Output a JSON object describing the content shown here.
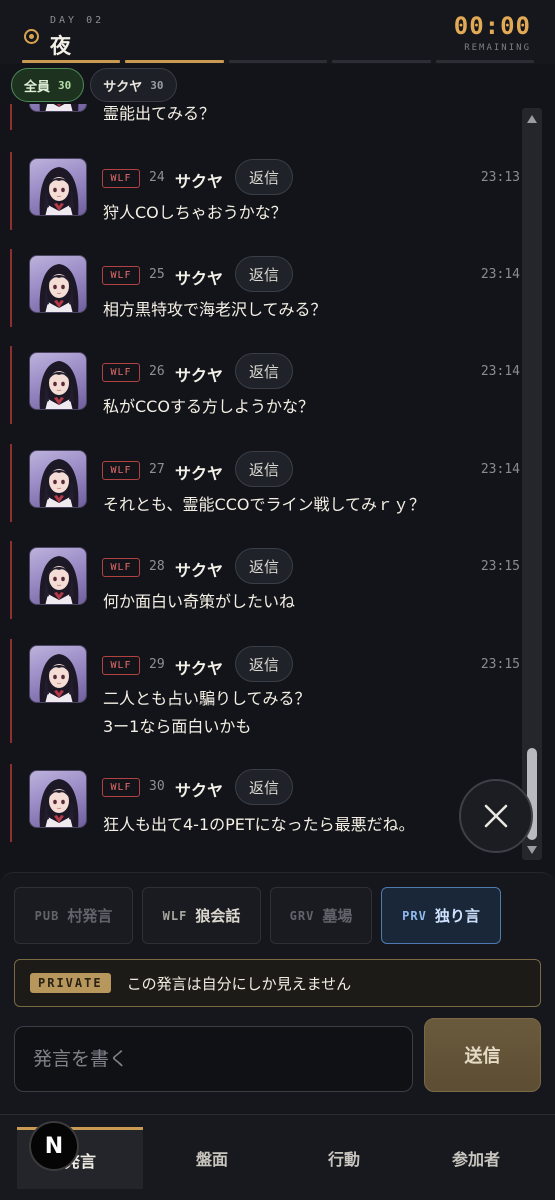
{
  "header": {
    "day_label": "DAY 02",
    "phase": "夜",
    "timer": "00:00",
    "timer_label": "REMAINING"
  },
  "filters": [
    {
      "label": "全員",
      "count": "30"
    },
    {
      "label": "サクヤ",
      "count": "30"
    }
  ],
  "chat": {
    "partial_top_text": "霊能出てみる？",
    "messages": [
      {
        "tag": "WLF",
        "num": "24",
        "name": "サクヤ",
        "reply": "返信",
        "time": "23:13",
        "lines": [
          "狩人COしちゃおうかな？"
        ]
      },
      {
        "tag": "WLF",
        "num": "25",
        "name": "サクヤ",
        "reply": "返信",
        "time": "23:14",
        "lines": [
          "相方黒特攻で海老沢してみる？"
        ]
      },
      {
        "tag": "WLF",
        "num": "26",
        "name": "サクヤ",
        "reply": "返信",
        "time": "23:14",
        "lines": [
          "私がCCOする方しようかな？"
        ]
      },
      {
        "tag": "WLF",
        "num": "27",
        "name": "サクヤ",
        "reply": "返信",
        "time": "23:14",
        "lines": [
          "それとも、霊能CCOでライン戦してみｒｙ？"
        ]
      },
      {
        "tag": "WLF",
        "num": "28",
        "name": "サクヤ",
        "reply": "返信",
        "time": "23:15",
        "lines": [
          "何か面白い奇策がしたいね"
        ]
      },
      {
        "tag": "WLF",
        "num": "29",
        "name": "サクヤ",
        "reply": "返信",
        "time": "23:15",
        "lines": [
          "二人とも占い騙りしてみる？",
          "3ー1なら面白いかも"
        ]
      },
      {
        "tag": "WLF",
        "num": "30",
        "name": "サクヤ",
        "reply": "返信",
        "time": "",
        "lines": [
          "狂人も出て4-1のPETになったら最悪だね。"
        ]
      }
    ]
  },
  "channels": [
    {
      "code": "PUB",
      "label": "村発言"
    },
    {
      "code": "WLF",
      "label": "狼会話"
    },
    {
      "code": "GRV",
      "label": "墓場"
    },
    {
      "code": "PRV",
      "label": "独り言"
    }
  ],
  "notice": {
    "badge": "PRIVATE",
    "text": "この発言は自分にしか見えません"
  },
  "composer": {
    "placeholder": "発言を書く",
    "send_label": "送信"
  },
  "nav": [
    {
      "label": "発言"
    },
    {
      "label": "盤面"
    },
    {
      "label": "行動"
    },
    {
      "label": "参加者"
    }
  ],
  "fab_letter": "N",
  "colors": {
    "accent": "#c99b52",
    "wolf_red": "#b24242",
    "active_filter": "#4e8a55",
    "private_channel": "#4d7bb0"
  }
}
